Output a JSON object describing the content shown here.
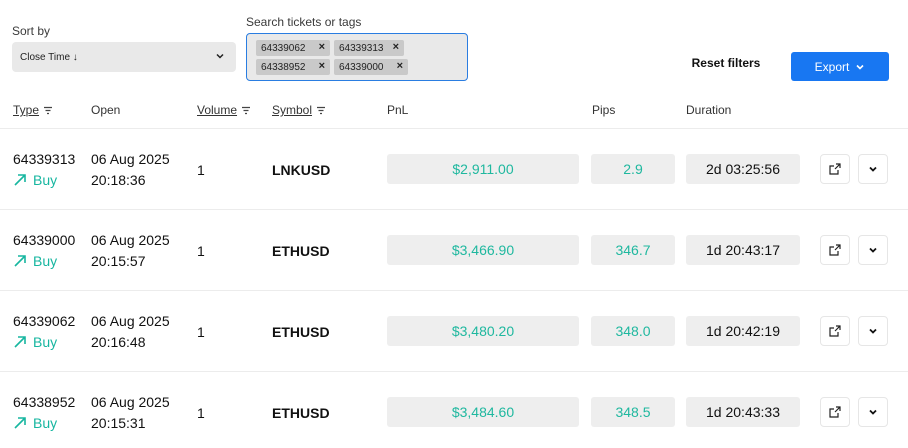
{
  "filters": {
    "sort_label": "Sort by",
    "sort_value": "Close Time ↓",
    "search_label": "Search tickets or tags",
    "chips": [
      "64339062",
      "64339313",
      "64338952",
      "64339000"
    ],
    "reset_label": "Reset filters",
    "export_label": "Export"
  },
  "table": {
    "headers": {
      "type": "Type",
      "open": "Open",
      "volume": "Volume",
      "symbol": "Symbol",
      "pnl": "PnL",
      "pips": "Pips",
      "duration": "Duration"
    },
    "rows": [
      {
        "ticket": "64339313",
        "side": "Buy",
        "date": "06 Aug 2025",
        "time": "20:18:36",
        "volume": "1",
        "symbol": "LNKUSD",
        "pnl": "$2,911.00",
        "pips": "2.9",
        "duration": "2d 03:25:56"
      },
      {
        "ticket": "64339000",
        "side": "Buy",
        "date": "06 Aug 2025",
        "time": "20:15:57",
        "volume": "1",
        "symbol": "ETHUSD",
        "pnl": "$3,466.90",
        "pips": "346.7",
        "duration": "1d 20:43:17"
      },
      {
        "ticket": "64339062",
        "side": "Buy",
        "date": "06 Aug 2025",
        "time": "20:16:48",
        "volume": "1",
        "symbol": "ETHUSD",
        "pnl": "$3,480.20",
        "pips": "348.0",
        "duration": "1d 20:42:19"
      },
      {
        "ticket": "64338952",
        "side": "Buy",
        "date": "06 Aug 2025",
        "time": "20:15:31",
        "volume": "1",
        "symbol": "ETHUSD",
        "pnl": "$3,484.60",
        "pips": "348.5",
        "duration": "1d 20:43:33"
      }
    ]
  },
  "colors": {
    "accent": "#1877f2",
    "profit": "#1fb89f",
    "buy": "#17b6a0"
  }
}
